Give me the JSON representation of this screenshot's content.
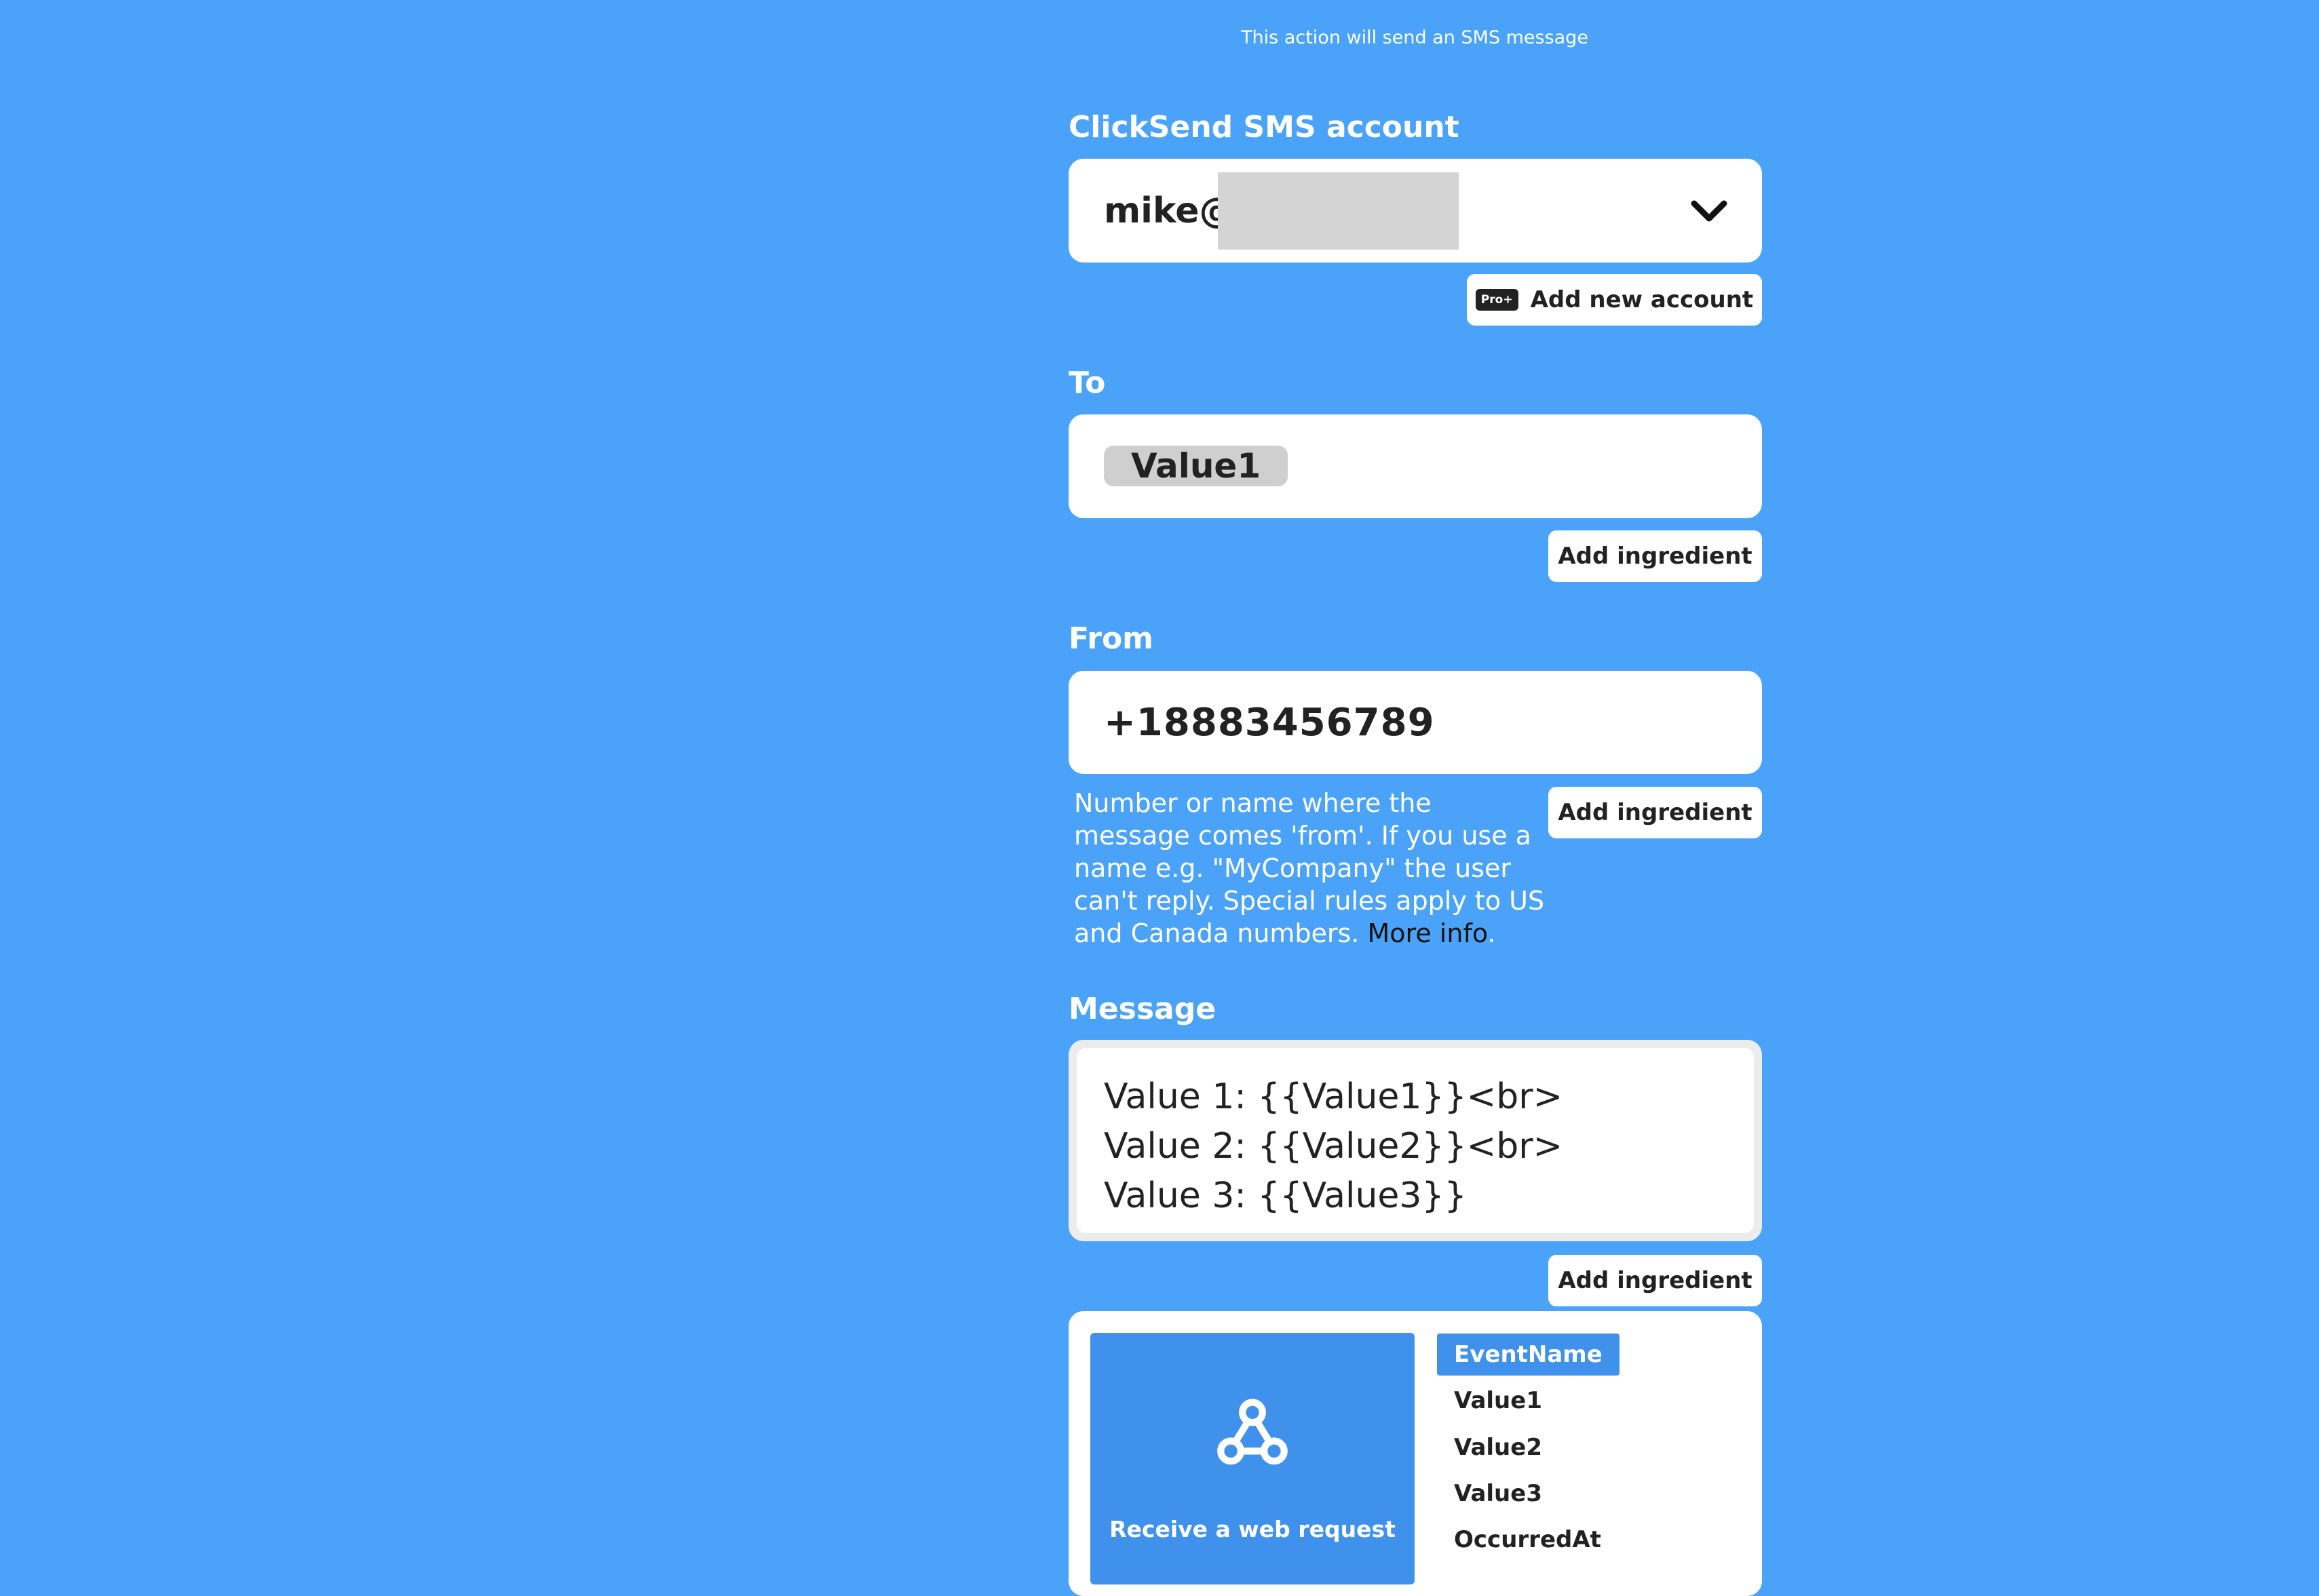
{
  "header": {
    "notice": "This action will send an SMS message"
  },
  "account": {
    "label": "ClickSend SMS account",
    "value": "mike@",
    "add_account_badge": "Pro+",
    "add_account_label": "Add new account"
  },
  "to": {
    "label": "To",
    "ingredient_pill": "Value1",
    "add_ingredient": "Add ingredient"
  },
  "from": {
    "label": "From",
    "value": "+18883456789",
    "add_ingredient": "Add ingredient",
    "help_text": "Number or name where the message comes 'from'. If you use a name e.g. \"MyCompany\" the user can't reply. Special rules apply to US and Canada numbers. ",
    "more_info": "More info",
    "help_end": "."
  },
  "message": {
    "label": "Message",
    "lines": [
      "Value 1: {{Value1}}<br>",
      "Value 2: {{Value2}}<br>",
      "Value 3: {{Value3}}"
    ],
    "add_ingredient": "Add ingredient"
  },
  "ingredients": {
    "trigger_label": "Receive a web request",
    "trigger_icon": "webhook-icon",
    "items": [
      "EventName",
      "Value1",
      "Value2",
      "Value3",
      "OccurredAt"
    ],
    "active_item": "EventName",
    "accent_color": "#3f91ec"
  },
  "colors": {
    "background": "#4aa3f9"
  }
}
